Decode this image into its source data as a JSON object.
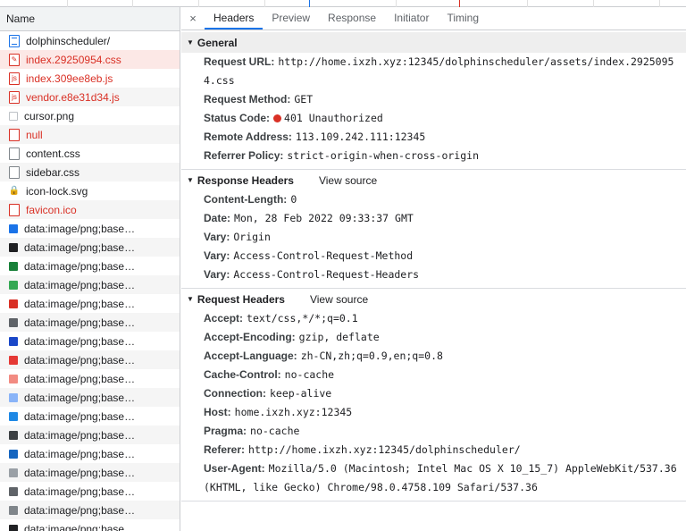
{
  "list": {
    "header": "Name",
    "items": [
      {
        "name": "dolphinscheduler/",
        "icon": "document-icon",
        "state": "normal"
      },
      {
        "name": "index.29250954.css",
        "icon": "stylesheet-icon",
        "state": "selected"
      },
      {
        "name": "index.309ee8eb.js",
        "icon": "script-icon",
        "state": "error"
      },
      {
        "name": "vendor.e8e31d34.js",
        "icon": "script-icon",
        "state": "error"
      },
      {
        "name": "cursor.png",
        "icon": "image-icon",
        "state": "normal"
      },
      {
        "name": "null",
        "icon": "file-icon",
        "state": "error"
      },
      {
        "name": "content.css",
        "icon": "file-icon",
        "state": "normal"
      },
      {
        "name": "sidebar.css",
        "icon": "file-icon",
        "state": "normal"
      },
      {
        "name": "icon-lock.svg",
        "icon": "lock-icon",
        "state": "normal"
      },
      {
        "name": "favicon.ico",
        "icon": "file-icon",
        "state": "error"
      },
      {
        "name": "data:image/png;base…",
        "icon": "image-icon",
        "state": "normal",
        "color": "#1a73e8"
      },
      {
        "name": "data:image/png;base…",
        "icon": "image-icon",
        "state": "normal",
        "color": "#202124"
      },
      {
        "name": "data:image/png;base…",
        "icon": "image-icon",
        "state": "normal",
        "color": "#188038"
      },
      {
        "name": "data:image/png;base…",
        "icon": "image-icon",
        "state": "normal",
        "color": "#34a853"
      },
      {
        "name": "data:image/png;base…",
        "icon": "image-icon",
        "state": "normal",
        "color": "#d93025"
      },
      {
        "name": "data:image/png;base…",
        "icon": "image-icon",
        "state": "normal",
        "color": "#5f6368"
      },
      {
        "name": "data:image/png;base…",
        "icon": "image-icon",
        "state": "normal",
        "color": "#1a47c8"
      },
      {
        "name": "data:image/png;base…",
        "icon": "image-icon",
        "state": "normal",
        "color": "#e53935"
      },
      {
        "name": "data:image/png;base…",
        "icon": "image-icon",
        "state": "normal",
        "color": "#f28b82"
      },
      {
        "name": "data:image/png;base…",
        "icon": "image-icon",
        "state": "normal",
        "color": "#8ab4f8"
      },
      {
        "name": "data:image/png;base…",
        "icon": "image-icon",
        "state": "normal",
        "color": "#1e88e5"
      },
      {
        "name": "data:image/png;base…",
        "icon": "image-icon",
        "state": "normal",
        "color": "#3c4043"
      },
      {
        "name": "data:image/png;base…",
        "icon": "image-icon",
        "state": "normal",
        "color": "#1565c0"
      },
      {
        "name": "data:image/png;base…",
        "icon": "image-icon",
        "state": "normal",
        "color": "#9aa0a6"
      },
      {
        "name": "data:image/png;base…",
        "icon": "image-icon",
        "state": "normal",
        "color": "#5f6368"
      },
      {
        "name": "data:image/png;base…",
        "icon": "image-icon",
        "state": "normal",
        "color": "#80868b"
      },
      {
        "name": "data:image/png;base…",
        "icon": "image-icon",
        "state": "normal",
        "color": "#202124"
      }
    ]
  },
  "tabs": {
    "close": "×",
    "items": [
      "Headers",
      "Preview",
      "Response",
      "Initiator",
      "Timing"
    ],
    "active": "Headers"
  },
  "general": {
    "title": "General",
    "rows": [
      {
        "k": "Request URL:",
        "v": "http://home.ixzh.xyz:12345/dolphinscheduler/assets/index.29250954.css"
      },
      {
        "k": "Request Method:",
        "v": "GET"
      },
      {
        "k": "Status Code:",
        "v": "401 Unauthorized",
        "status": true
      },
      {
        "k": "Remote Address:",
        "v": "113.109.242.111:12345"
      },
      {
        "k": "Referrer Policy:",
        "v": "strict-origin-when-cross-origin"
      }
    ]
  },
  "response_headers": {
    "title": "Response Headers",
    "view_source": "View source",
    "rows": [
      {
        "k": "Content-Length:",
        "v": "0"
      },
      {
        "k": "Date:",
        "v": "Mon, 28 Feb 2022 09:33:37 GMT"
      },
      {
        "k": "Vary:",
        "v": "Origin"
      },
      {
        "k": "Vary:",
        "v": "Access-Control-Request-Method"
      },
      {
        "k": "Vary:",
        "v": "Access-Control-Request-Headers"
      }
    ]
  },
  "request_headers": {
    "title": "Request Headers",
    "view_source": "View source",
    "rows": [
      {
        "k": "Accept:",
        "v": "text/css,*/*;q=0.1"
      },
      {
        "k": "Accept-Encoding:",
        "v": "gzip, deflate"
      },
      {
        "k": "Accept-Language:",
        "v": "zh-CN,zh;q=0.9,en;q=0.8"
      },
      {
        "k": "Cache-Control:",
        "v": "no-cache"
      },
      {
        "k": "Connection:",
        "v": "keep-alive"
      },
      {
        "k": "Host:",
        "v": "home.ixzh.xyz:12345"
      },
      {
        "k": "Pragma:",
        "v": "no-cache"
      },
      {
        "k": "Referer:",
        "v": "http://home.ixzh.xyz:12345/dolphinscheduler/"
      },
      {
        "k": "User-Agent:",
        "v": "Mozilla/5.0 (Macintosh; Intel Mac OS X 10_15_7) AppleWebKit/537.36 (KHTML, like Gecko) Chrome/98.0.4758.109 Safari/537.36"
      }
    ]
  },
  "colors": {
    "accent": "#1a73e8",
    "error": "#d93025",
    "selected_bg": "#fce8e6"
  }
}
